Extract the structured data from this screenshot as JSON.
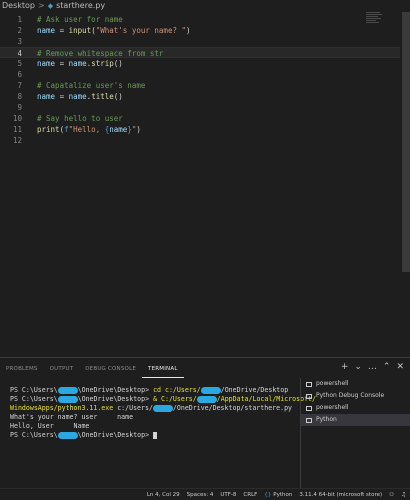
{
  "breadcrumb": {
    "folder": "Desktop",
    "separator": ">",
    "file": "starthere.py"
  },
  "editor": {
    "lines": [
      {
        "n": "1",
        "tokens": [
          {
            "c": "cm",
            "t": "# Ask user for name"
          }
        ]
      },
      {
        "n": "2",
        "tokens": [
          {
            "c": "var",
            "t": "name"
          },
          {
            "c": "op",
            "t": " = "
          },
          {
            "c": "fn",
            "t": "input"
          },
          {
            "c": "op",
            "t": "("
          },
          {
            "c": "str",
            "t": "\"What's your name? \""
          },
          {
            "c": "op",
            "t": ")"
          }
        ]
      },
      {
        "n": "3",
        "tokens": []
      },
      {
        "n": "4",
        "tokens": [
          {
            "c": "cm",
            "t": "# Remove whitespace from str"
          }
        ]
      },
      {
        "n": "5",
        "tokens": [
          {
            "c": "var",
            "t": "name"
          },
          {
            "c": "op",
            "t": " = "
          },
          {
            "c": "var",
            "t": "name"
          },
          {
            "c": "op",
            "t": "."
          },
          {
            "c": "fn",
            "t": "strip"
          },
          {
            "c": "op",
            "t": "()"
          }
        ]
      },
      {
        "n": "6",
        "tokens": []
      },
      {
        "n": "7",
        "tokens": [
          {
            "c": "cm",
            "t": "# Capatalize user's name"
          }
        ]
      },
      {
        "n": "8",
        "tokens": [
          {
            "c": "var",
            "t": "name"
          },
          {
            "c": "op",
            "t": " = "
          },
          {
            "c": "var",
            "t": "name"
          },
          {
            "c": "op",
            "t": "."
          },
          {
            "c": "fn",
            "t": "title"
          },
          {
            "c": "op",
            "t": "()"
          }
        ]
      },
      {
        "n": "9",
        "tokens": []
      },
      {
        "n": "10",
        "tokens": [
          {
            "c": "cm",
            "t": "# Say hello to user"
          }
        ]
      },
      {
        "n": "11",
        "tokens": [
          {
            "c": "fn",
            "t": "print"
          },
          {
            "c": "op",
            "t": "("
          },
          {
            "c": "kw",
            "t": "f"
          },
          {
            "c": "str",
            "t": "\"Hello, "
          },
          {
            "c": "kw",
            "t": "{"
          },
          {
            "c": "var",
            "t": "name"
          },
          {
            "c": "kw",
            "t": "}"
          },
          {
            "c": "str",
            "t": "\""
          },
          {
            "c": "op",
            "t": ")"
          }
        ]
      },
      {
        "n": "12",
        "tokens": []
      }
    ],
    "current_line_index": 3
  },
  "panel": {
    "tabs": [
      "PROBLEMS",
      "OUTPUT",
      "DEBUG CONSOLE",
      "TERMINAL"
    ],
    "active_tab": "TERMINAL",
    "actions": [
      "+",
      "⌄",
      "…",
      "⌃",
      "✕"
    ]
  },
  "terminal": {
    "line1_a": "PS C:\\Users\\",
    "line1_b": "\\OneDrive\\Desktop> ",
    "line1_cmd": "cd c:/Users/",
    "line1_cmd2": "/OneDrive/Desktop",
    "line2_a": "PS C:\\Users\\",
    "line2_b": "\\OneDrive\\Desktop> ",
    "line2_cmd": "& C:/Users/",
    "line2_cmd2": "/AppData/Local/Microsoft/",
    "line3_cmd": "WindowsApps/python3.11.exe",
    "line3_rest": " c:/Users/",
    "line3_rest2": "/OneDrive/Desktop/starthere.py",
    "line4": "What's your name? user     name",
    "line5": "Hello, User     Name",
    "line6_a": "PS C:\\Users\\",
    "line6_b": "\\OneDrive\\Desktop> "
  },
  "terminal_list": [
    "powershell",
    "Python Debug Console",
    "powershell",
    "Python"
  ],
  "terminal_selected_index": 3,
  "statusbar": {
    "position": "Ln 4, Col 29",
    "spaces": "Spaces: 4",
    "encoding": "UTF-8",
    "eol": "CRLF",
    "language": "Python",
    "interpreter": "3.11.4 64-bit (microsoft store)"
  },
  "colors": {
    "redaction": "#2aa9e0",
    "background": "#1e1e1e"
  }
}
